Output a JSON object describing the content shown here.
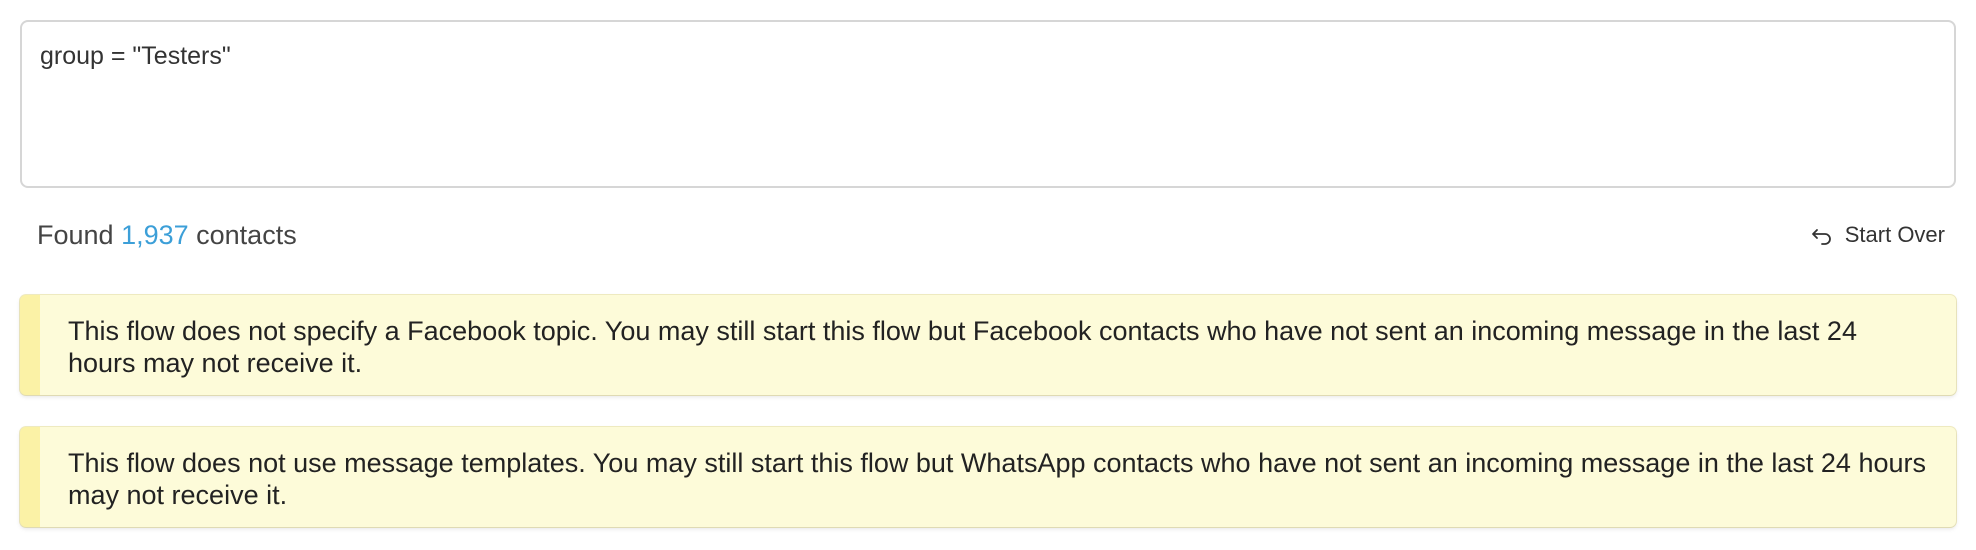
{
  "query": {
    "value": "group = \"Testers\""
  },
  "summary": {
    "found_prefix": "Found ",
    "count": "1,937",
    "found_suffix": " contacts",
    "start_over_label": "Start Over",
    "start_over_icon": "undo-arrow-icon"
  },
  "warnings": [
    {
      "text": "This flow does not specify a Facebook topic. You may still start this flow but Facebook contacts who have not sent an incoming message in the last 24 hours may not receive it."
    },
    {
      "text": "This flow does not use message templates. You may still start this flow but WhatsApp contacts who have not sent an incoming message in the last 24 hours may not receive it."
    }
  ],
  "colors": {
    "count_link": "#3c9fd8",
    "warning_bg": "#fdfbd9",
    "warning_border": "#fbf2a6"
  }
}
